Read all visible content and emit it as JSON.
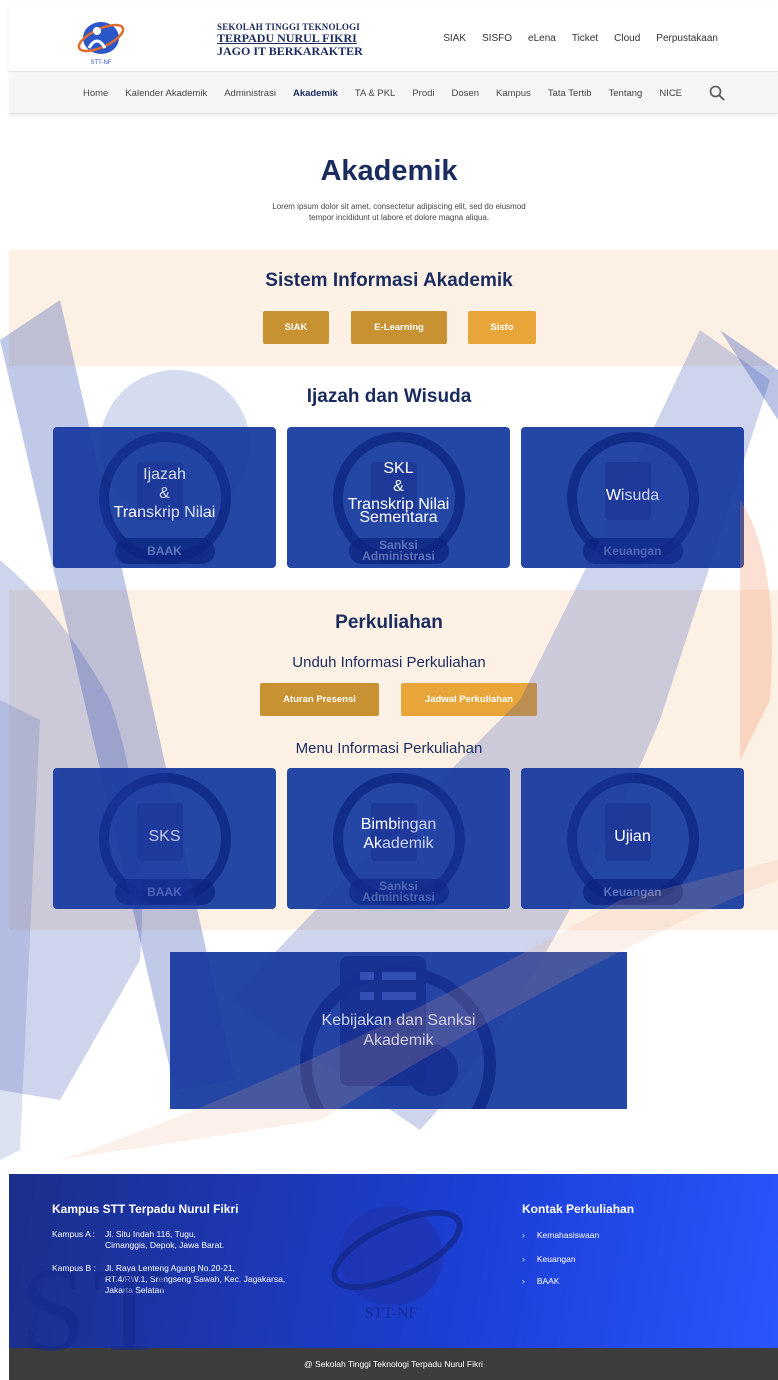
{
  "header": {
    "school_line1": "SEKOLAH TINGGI TEKNOLOGI",
    "school_line2": "TERPADU NURUL FIKRI",
    "school_line3": "JAGO IT BERKARAKTER",
    "logo_text": "STT-NF",
    "top_links": [
      "SIAK",
      "SISFO",
      "eLena",
      "Ticket",
      "Cloud",
      "Perpustakaan"
    ]
  },
  "nav": {
    "items": [
      "Home",
      "Kalender Akademik",
      "Administrasi",
      "Akademik",
      "TA & PKL",
      "Prodi",
      "Dosen",
      "Kampus",
      "Tata Tertib",
      "Tentang",
      "NICE"
    ],
    "active": "Akademik",
    "search_icon": "search-icon"
  },
  "hero": {
    "title": "Akademik",
    "subtitle": "Lorem ipsum dolor sit amet, consectetur adipiscing elit, sed do eiusmod tempor incididunt ut labore et dolore magna aliqua."
  },
  "sia": {
    "title": "Sistem Informasi Akademik",
    "buttons": [
      "SIAK",
      "E-Learning",
      "Sisfo"
    ]
  },
  "ijazah": {
    "title": "Ijazah dan Wisuda",
    "cards": [
      {
        "label_lines": [
          "Ijazah",
          "&",
          "Transkrip Nilai"
        ],
        "tag": "BAAK"
      },
      {
        "label_lines": [
          "SKL",
          "&",
          "Transkrip Nilai",
          "Sementara"
        ],
        "tag": "Sanksi Administrasi"
      },
      {
        "label_lines": [
          "Wisuda"
        ],
        "tag": "Keuangan"
      }
    ]
  },
  "perkuliahan": {
    "title": "Perkuliahan",
    "download_title": "Unduh Informasi Perkuliahan",
    "download_buttons": [
      "Aturan Presensi",
      "Jadwal Perkuliahan"
    ],
    "menu_title": "Menu Informasi Perkuliahan",
    "cards": [
      {
        "label_lines": [
          "SKS"
        ],
        "tag": "BAAK"
      },
      {
        "label_lines": [
          "Bimbingan",
          "Akademik"
        ],
        "tag": "Sanksi Administrasi"
      },
      {
        "label_lines": [
          "Ujian"
        ],
        "tag": "Keuangan"
      }
    ]
  },
  "policy": {
    "label_lines": [
      "Kebijakan dan Sanksi",
      "Akademik"
    ]
  },
  "footer": {
    "campus_title": "Kampus STT Terpadu Nurul Fikri",
    "campus_a_key": "Kampus A :",
    "campus_a_lines": [
      "Jl. Situ Indah 116, Tugu,",
      "Cimanggis, Depok, Jawa Barat."
    ],
    "campus_b_key": "Kampus B :",
    "campus_b_lines": [
      "Jl. Raya Lenteng Agung No.20-21,",
      "RT.4/RW.1, Srengseng Sawah, Kec. Jagakarsa,",
      "Jakarta Selatan"
    ],
    "contact_title": "Kontak Perkuliahan",
    "contacts": [
      "Kemahasiswaan",
      "Keuangan",
      "BAAK"
    ],
    "watermark_text": "STT-NF",
    "copyright": "@ Sekolah Tinggi Teknologi Terpadu Nurul Fikri"
  },
  "colors": {
    "navy": "#1a2b5e",
    "gold_button": "#c89131",
    "card_blue": "#2446a4",
    "band_peach": "#fdf1e6",
    "footer_blue": "#1c3fd6"
  }
}
